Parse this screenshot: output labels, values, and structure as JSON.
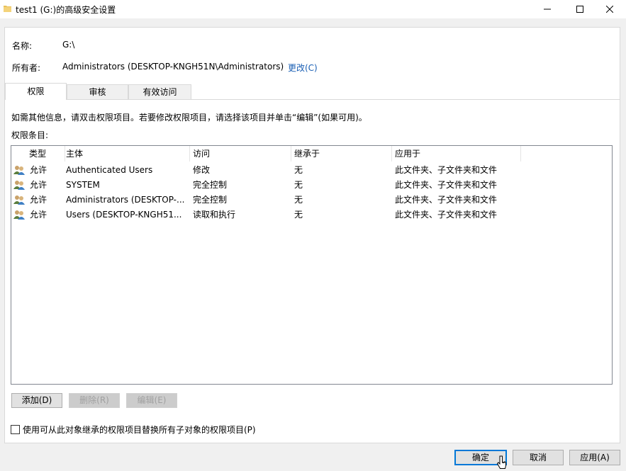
{
  "window": {
    "title": "test1 (G:)的高级安全设置"
  },
  "info": {
    "name_label": "名称:",
    "name_value": "G:\\",
    "owner_label": "所有者:",
    "owner_value": "Administrators (DESKTOP-KNGH51N\\Administrators)",
    "owner_change_link": "更改(C)"
  },
  "tabs": [
    {
      "label": "权限",
      "active": true
    },
    {
      "label": "审核",
      "active": false
    },
    {
      "label": "有效访问",
      "active": false
    }
  ],
  "instructions": "如需其他信息，请双击权限项目。若要修改权限项目，请选择该项目并单击“编辑”(如果可用)。",
  "entries_label": "权限条目:",
  "permissions": {
    "columns": [
      "类型",
      "主体",
      "访问",
      "继承于",
      "应用于"
    ],
    "rows": [
      {
        "type": "允许",
        "principal": "Authenticated Users",
        "access": "修改",
        "inherited": "无",
        "applies": "此文件夹、子文件夹和文件"
      },
      {
        "type": "允许",
        "principal": "SYSTEM",
        "access": "完全控制",
        "inherited": "无",
        "applies": "此文件夹、子文件夹和文件"
      },
      {
        "type": "允许",
        "principal": "Administrators (DESKTOP-...",
        "access": "完全控制",
        "inherited": "无",
        "applies": "此文件夹、子文件夹和文件"
      },
      {
        "type": "允许",
        "principal": "Users (DESKTOP-KNGH51...",
        "access": "读取和执行",
        "inherited": "无",
        "applies": "此文件夹、子文件夹和文件"
      }
    ]
  },
  "buttons": {
    "add": "添加(D)",
    "remove": "删除(R)",
    "edit": "编辑(E)"
  },
  "replace_checkbox": {
    "label": "使用可从此对象继承的权限项目替换所有子对象的权限项目(P)",
    "checked": false
  },
  "footer": {
    "ok": "确定",
    "cancel": "取消",
    "apply": "应用(A)"
  },
  "colors": {
    "link": "#1a5fb4",
    "default_button_border": "#0078d7"
  }
}
